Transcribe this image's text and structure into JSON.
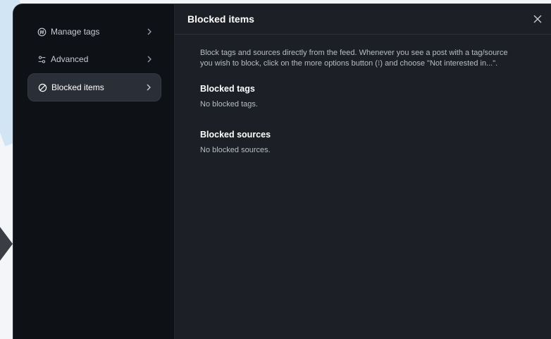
{
  "sidebar": {
    "items": [
      {
        "label": "Manage tags",
        "icon": "hashtag-icon"
      },
      {
        "label": "Advanced",
        "icon": "sliders-icon"
      },
      {
        "label": "Blocked items",
        "icon": "block-icon",
        "active": true
      }
    ]
  },
  "header": {
    "title": "Blocked items"
  },
  "content": {
    "description": "Block tags and sources directly from the feed. Whenever you see a post with a tag/source you wish to block, click on the more options button (⁝) and choose \"Not interested in...\".",
    "tags_title": "Blocked tags",
    "tags_empty": "No blocked tags.",
    "sources_title": "Blocked sources",
    "sources_empty": "No blocked sources."
  },
  "colors": {
    "modal_bg": "#0e1116",
    "panel_bg": "#1c1f26",
    "active_item_bg": "#2a2e36",
    "text_primary": "#ffffff",
    "text_secondary": "#b7bcc6"
  }
}
